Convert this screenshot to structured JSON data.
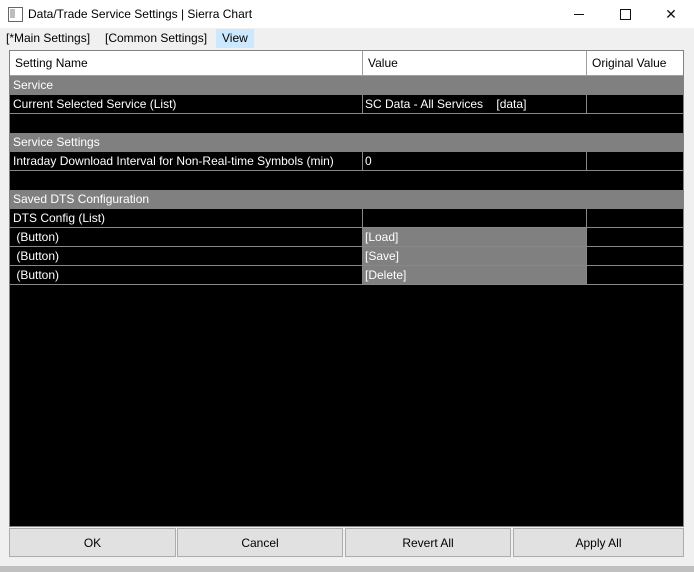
{
  "window": {
    "title": "Data/Trade Service Settings | Sierra Chart",
    "minimize_glyph": "minimize-icon",
    "maximize_glyph": "maximize-icon",
    "close_glyph": "✕"
  },
  "menu": {
    "items": [
      "[*Main Settings]",
      "[Common Settings]",
      "View"
    ]
  },
  "grid": {
    "headers": [
      "Setting Name",
      "Value",
      "Original Value"
    ],
    "sections": [
      {
        "title": "Service",
        "rows": [
          {
            "name": "Current Selected Service (List)",
            "value": "SC Data - All Services    [data]",
            "original": ""
          }
        ]
      },
      {
        "title": "Service Settings",
        "rows": [
          {
            "name": "Intraday Download Interval for Non-Real-time Symbols (min)",
            "value": "0",
            "original": ""
          }
        ]
      },
      {
        "title": "Saved DTS Configuration",
        "rows": [
          {
            "name": "DTS Config (List)",
            "value": "",
            "original": ""
          },
          {
            "name": " (Button)",
            "value": "[Load]",
            "original": ""
          },
          {
            "name": " (Button)",
            "value": "[Save]",
            "original": ""
          },
          {
            "name": " (Button)",
            "value": "[Delete]",
            "original": ""
          }
        ]
      }
    ]
  },
  "buttons": {
    "ok": "OK",
    "cancel": "Cancel",
    "revert_all": "Revert All",
    "apply_all": "Apply All"
  },
  "colors": {
    "grid_background": "#000000",
    "section_background": "#808080",
    "menu_highlight": "#cce8ff"
  }
}
